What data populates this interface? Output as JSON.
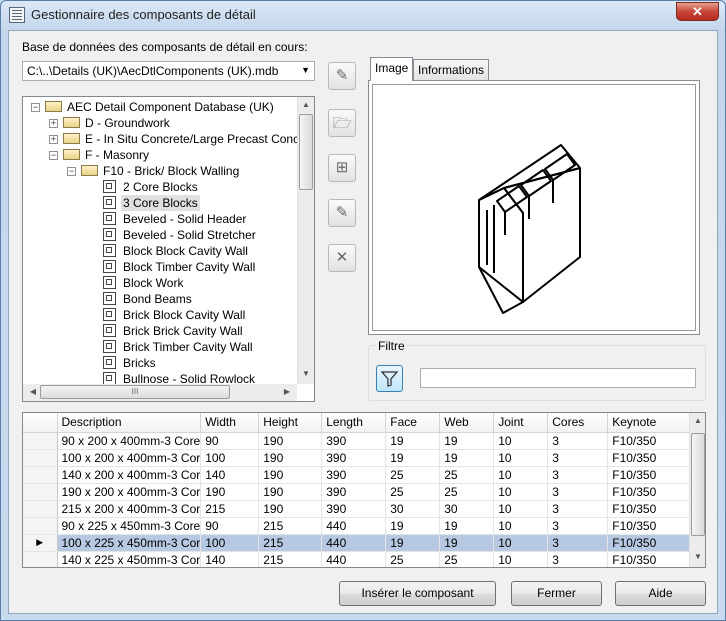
{
  "window": {
    "title": "Gestionnaire des composants de détail",
    "close_label": "✕"
  },
  "database": {
    "label": "Base de données des composants de détail en cours:",
    "path": "C:\\..\\Details (UK)\\AecDtlComponents (UK).mdb"
  },
  "tree": {
    "root": "AEC Detail Component Database (UK)",
    "groups": [
      {
        "label": "D - Groundwork",
        "expand": "+"
      },
      {
        "label": "E - In Situ Concrete/Large Precast Concrete",
        "expand": "+"
      },
      {
        "label": "F - Masonry",
        "expand": "−"
      }
    ],
    "subgroup": "F10 - Brick/ Block Walling",
    "items": [
      "2 Core Blocks",
      "3 Core Blocks",
      "Beveled - Solid Header",
      "Beveled - Solid Stretcher",
      "Block Block Cavity Wall",
      "Block Timber Cavity Wall",
      "Block Work",
      "Bond Beams",
      "Brick Block Cavity Wall",
      "Brick Brick Cavity Wall",
      "Brick Timber Cavity Wall",
      "Bricks",
      "Bullnose - Solid Rowlock"
    ],
    "selected_index": 1,
    "scroll_grip": "III"
  },
  "tabs": [
    {
      "label": "Image"
    },
    {
      "label": "Informations"
    }
  ],
  "filter": {
    "label": "Filtre",
    "value": ""
  },
  "table": {
    "columns": [
      "Description",
      "Width",
      "Height",
      "Length",
      "Face",
      "Web",
      "Joint",
      "Cores",
      "Keynote"
    ],
    "rows": [
      [
        "90 x 200 x 400mm-3 Core",
        "90",
        "190",
        "390",
        "19",
        "19",
        "10",
        "3",
        "F10/350"
      ],
      [
        "100 x 200 x 400mm-3 Cor",
        "100",
        "190",
        "390",
        "19",
        "19",
        "10",
        "3",
        "F10/350"
      ],
      [
        "140 x 200 x 400mm-3 Cor",
        "140",
        "190",
        "390",
        "25",
        "25",
        "10",
        "3",
        "F10/350"
      ],
      [
        "190 x 200 x 400mm-3 Cor",
        "190",
        "190",
        "390",
        "25",
        "25",
        "10",
        "3",
        "F10/350"
      ],
      [
        "215 x 200 x 400mm-3 Cor",
        "215",
        "190",
        "390",
        "30",
        "30",
        "10",
        "3",
        "F10/350"
      ],
      [
        "90 x 225 x 450mm-3 Core",
        "90",
        "215",
        "440",
        "19",
        "19",
        "10",
        "3",
        "F10/350"
      ],
      [
        "100 x 225 x 450mm-3 Cor",
        "100",
        "215",
        "440",
        "19",
        "19",
        "10",
        "3",
        "F10/350"
      ],
      [
        "140 x 225 x 450mm-3 Cor",
        "140",
        "215",
        "440",
        "25",
        "25",
        "10",
        "3",
        "F10/350"
      ]
    ],
    "selected_row": 6,
    "current_marker": "▶"
  },
  "buttons": {
    "insert": "Insérer le composant",
    "close": "Fermer",
    "help": "Aide"
  },
  "icons": {
    "app": "app-icon",
    "edit_db": "database-edit-icon",
    "open_db": "folder-open-icon",
    "add": "add-component-icon",
    "edit": "edit-component-icon",
    "delete": "delete-icon",
    "filter": "funnel-icon"
  },
  "colors": {
    "selection_row": "#b7c9e2",
    "titlebar": "#c3d6ec",
    "close_button": "#c8453a"
  }
}
